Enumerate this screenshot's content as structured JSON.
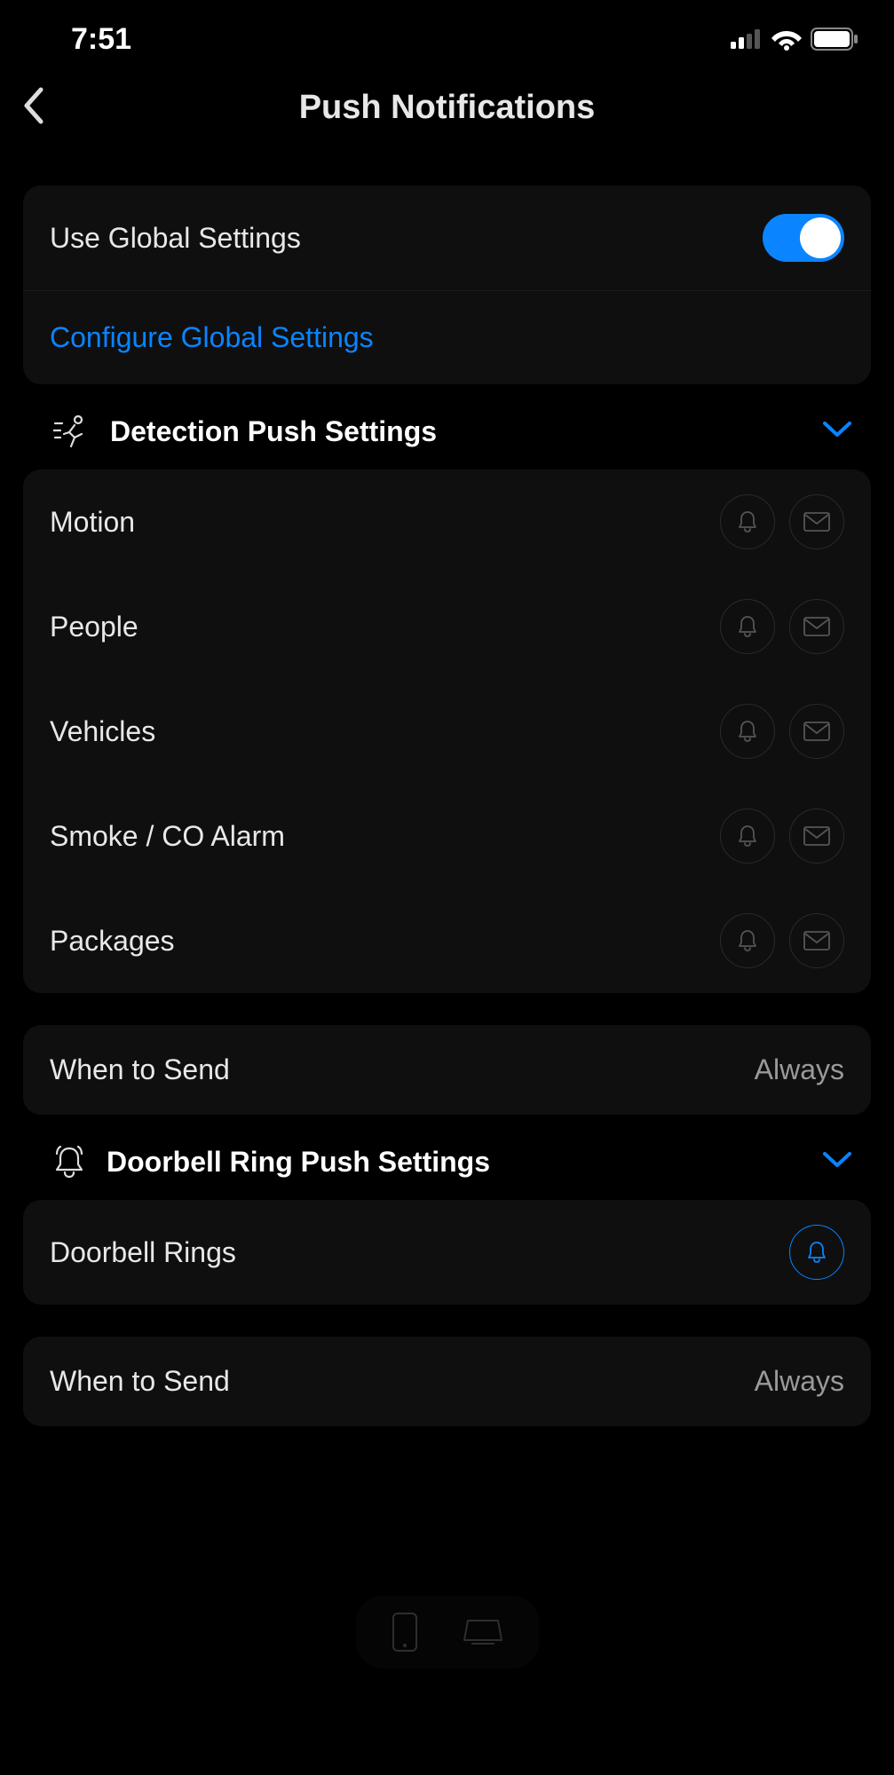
{
  "status": {
    "time": "7:51"
  },
  "header": {
    "title": "Push Notifications"
  },
  "global": {
    "use_label": "Use Global Settings",
    "configure_label": "Configure Global Settings"
  },
  "detection": {
    "title": "Detection Push Settings",
    "items": [
      {
        "label": "Motion"
      },
      {
        "label": "People"
      },
      {
        "label": "Vehicles"
      },
      {
        "label": "Smoke / CO Alarm"
      },
      {
        "label": "Packages"
      }
    ]
  },
  "when_to_send": {
    "label": "When to Send",
    "value": "Always"
  },
  "doorbell": {
    "title": "Doorbell Ring Push Settings",
    "item_label": "Doorbell Rings",
    "when_label": "When to Send",
    "when_value": "Always"
  }
}
